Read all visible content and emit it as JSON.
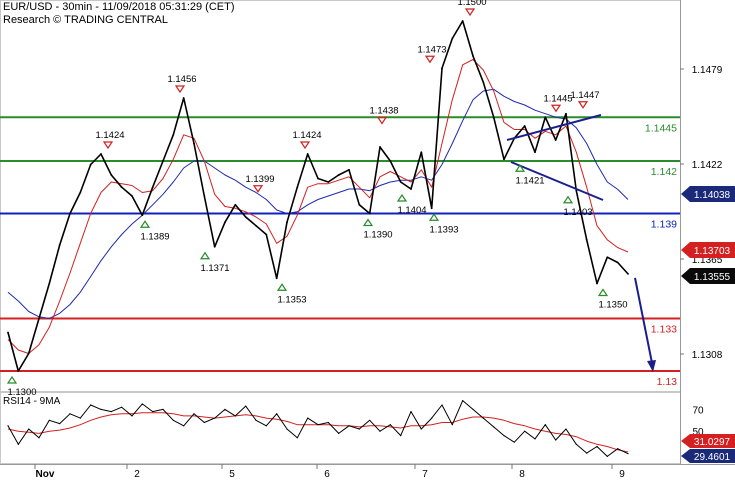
{
  "header": {
    "title": "EUR/USD - 30min - 11/09/2018 05:31:29 (CET)",
    "source": "Research © TRADING CENTRAL"
  },
  "colors": {
    "price": "#000000",
    "ma_fast": "#d42020",
    "ma_slow": "#1f2ab0",
    "level_green": "#2a8c2a",
    "level_blue": "#1020c0",
    "level_red": "#d42020",
    "trend_line": "#1a1f8c",
    "forecast_arrow": "#1a1f8c",
    "badge_red": "#d42020",
    "badge_dark": "#0a0a0a",
    "badge_navy": "#1a2a78",
    "marker_green": "#2a8c2a",
    "marker_red": "#d42020"
  },
  "chart_data": [
    {
      "type": "line",
      "title": "EUR/USD - 30min",
      "x_ticks": [
        "Nov",
        "2",
        "5",
        "6",
        "7",
        "8",
        "9"
      ],
      "y_ticks": [
        "1.1479",
        "1.1422",
        "1.1365",
        "1.1308"
      ],
      "ylim": [
        1.1288,
        1.1512
      ],
      "series": [
        {
          "name": "EUR/USD",
          "values": [
            1.1322,
            1.13,
            1.131,
            1.133,
            1.135,
            1.1372,
            1.139,
            1.1402,
            1.1418,
            1.1424,
            1.1412,
            1.1405,
            1.14,
            1.1389,
            1.1405,
            1.142,
            1.1435,
            1.1456,
            1.143,
            1.14,
            1.1371,
            1.1385,
            1.1395,
            1.1388,
            1.1383,
            1.1378,
            1.1353,
            1.1385,
            1.1405,
            1.1424,
            1.141,
            1.1408,
            1.1412,
            1.1415,
            1.1395,
            1.139,
            1.1428,
            1.142,
            1.1408,
            1.1404,
            1.1425,
            1.1393,
            1.1473,
            1.149,
            1.15,
            1.148,
            1.1465,
            1.1445,
            1.1421,
            1.1433,
            1.144,
            1.1425,
            1.1445,
            1.1432,
            1.1447,
            1.1403,
            1.1375,
            1.135,
            1.1365,
            1.1362,
            1.13555
          ]
        },
        {
          "name": "",
          "values": [
            1.1318,
            1.1312,
            1.131,
            1.1315,
            1.1325,
            1.134,
            1.1356,
            1.1373,
            1.139,
            1.1402,
            1.1408,
            1.1407,
            1.1406,
            1.1402,
            1.1403,
            1.141,
            1.1421,
            1.1435,
            1.1433,
            1.142,
            1.1401,
            1.1394,
            1.1393,
            1.1391,
            1.1388,
            1.1384,
            1.1373,
            1.1377,
            1.1389,
            1.1405,
            1.1407,
            1.1407,
            1.1409,
            1.1411,
            1.1405,
            1.1399,
            1.1411,
            1.1414,
            1.1411,
            1.1408,
            1.1415,
            1.1405,
            1.143,
            1.1455,
            1.1475,
            1.1478,
            1.1472,
            1.146,
            1.1442,
            1.1438,
            1.1438,
            1.1433,
            1.1437,
            1.1435,
            1.144,
            1.1425,
            1.1405,
            1.1383,
            1.1375,
            1.13705,
            1.1368
          ]
        },
        {
          "name": "",
          "values": [
            1.1345,
            1.134,
            1.1334,
            1.1331,
            1.133,
            1.1333,
            1.1338,
            1.1345,
            1.1354,
            1.1363,
            1.1371,
            1.1378,
            1.1384,
            1.1389,
            1.1395,
            1.1401,
            1.1408,
            1.1416,
            1.142,
            1.142,
            1.1416,
            1.1412,
            1.1409,
            1.1405,
            1.1402,
            1.1398,
            1.1392,
            1.139,
            1.1391,
            1.1395,
            1.1398,
            1.14,
            1.1402,
            1.1404,
            1.1404,
            1.1403,
            1.1406,
            1.1408,
            1.1409,
            1.1409,
            1.1411,
            1.1409,
            1.1418,
            1.143,
            1.1443,
            1.1455,
            1.146,
            1.1461,
            1.1457,
            1.1454,
            1.1452,
            1.1449,
            1.1447,
            1.1445,
            1.1444,
            1.1439,
            1.143,
            1.1418,
            1.1408,
            1.14038,
            1.1398
          ]
        }
      ],
      "horizontal_levels": [
        {
          "value": 1.1445,
          "label": "1.1445",
          "color": "green"
        },
        {
          "value": 1.142,
          "label": "1.142",
          "color": "green"
        },
        {
          "value": 1.139,
          "label": "1.139",
          "color": "blue"
        },
        {
          "value": 1.133,
          "label": "1.133",
          "color": "red"
        },
        {
          "value": 1.13,
          "label": "1.13",
          "color": "red"
        }
      ],
      "badges": [
        {
          "label": "1.14038",
          "color": "navy"
        },
        {
          "label": "1.13703",
          "color": "red"
        },
        {
          "label": "1.13555",
          "color": "dark"
        }
      ],
      "annotations": [
        {
          "label": "1.1300",
          "value": 1.13,
          "kind": "low"
        },
        {
          "label": "1.1424",
          "value": 1.1424,
          "kind": "high"
        },
        {
          "label": "1.1389",
          "value": 1.1389,
          "kind": "low"
        },
        {
          "label": "1.1456",
          "value": 1.1456,
          "kind": "high"
        },
        {
          "label": "1.1371",
          "value": 1.1371,
          "kind": "low"
        },
        {
          "label": "1.1399",
          "value": 1.1399,
          "kind": "high"
        },
        {
          "label": "1.1353",
          "value": 1.1353,
          "kind": "low"
        },
        {
          "label": "1.1424",
          "value": 1.1424,
          "kind": "high"
        },
        {
          "label": "1.1390",
          "value": 1.139,
          "kind": "low"
        },
        {
          "label": "1.1438",
          "value": 1.1438,
          "kind": "high"
        },
        {
          "label": "1.1404",
          "value": 1.1404,
          "kind": "low"
        },
        {
          "label": "1.1393",
          "value": 1.1393,
          "kind": "low"
        },
        {
          "label": "1.1473",
          "value": 1.1473,
          "kind": "high"
        },
        {
          "label": "1.1500",
          "value": 1.15,
          "kind": "high"
        },
        {
          "label": "1.1421",
          "value": 1.1421,
          "kind": "low"
        },
        {
          "label": "1.1445",
          "value": 1.1445,
          "kind": "high"
        },
        {
          "label": "1.1447",
          "value": 1.1447,
          "kind": "high"
        },
        {
          "label": "1.1403",
          "value": 1.1403,
          "kind": "low"
        },
        {
          "label": "1.1350",
          "value": 1.135,
          "kind": "low"
        }
      ],
      "forecast_target": 1.13,
      "grid": false
    },
    {
      "type": "line",
      "title": "RSI14 - 9MA",
      "ylim": [
        20,
        85
      ],
      "y_ticks": [
        "70",
        "50"
      ],
      "series": [
        {
          "name": "RSI14",
          "values": [
            55,
            38,
            52,
            44,
            60,
            57,
            66,
            62,
            74,
            70,
            68,
            72,
            64,
            75,
            68,
            70,
            60,
            55,
            66,
            58,
            62,
            70,
            64,
            73,
            60,
            55,
            66,
            52,
            44,
            62,
            56,
            58,
            48,
            55,
            52,
            60,
            50,
            56,
            46,
            68,
            52,
            62,
            74,
            56,
            78,
            70,
            62,
            54,
            46,
            40,
            50,
            43,
            56,
            42,
            52,
            38,
            30,
            36,
            27,
            34,
            29.4601
          ]
        },
        {
          "name": "9MA",
          "values": [
            52,
            50,
            49,
            48,
            50,
            51,
            53,
            56,
            60,
            63,
            65,
            66,
            66,
            67,
            67,
            67,
            66,
            64,
            64,
            63,
            62,
            63,
            64,
            65,
            64,
            62,
            61,
            59,
            56,
            56,
            56,
            56,
            55,
            55,
            54,
            55,
            55,
            54,
            53,
            55,
            55,
            56,
            58,
            58,
            61,
            63,
            63,
            62,
            60,
            57,
            55,
            52,
            50,
            48,
            47,
            45,
            41,
            38,
            36,
            33,
            31.0297
          ]
        }
      ],
      "badges": [
        {
          "label": "31.0297",
          "color": "red"
        },
        {
          "label": "29.4601",
          "color": "navy"
        }
      ]
    }
  ]
}
